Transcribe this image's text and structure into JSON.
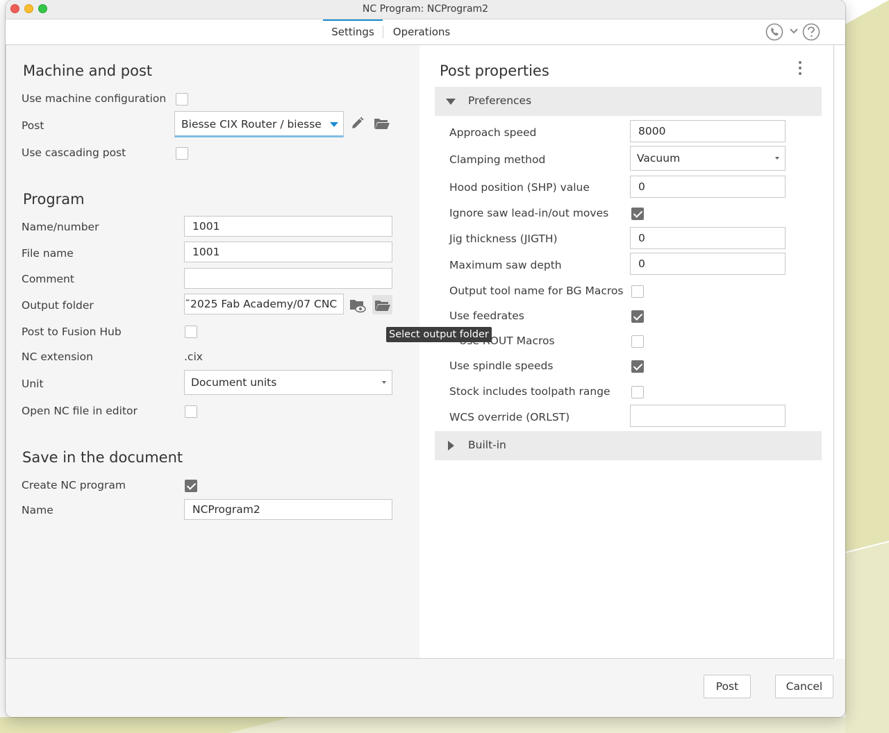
{
  "window": {
    "title": "NC Program: NCProgram2"
  },
  "tabs": [
    {
      "label": "Settings",
      "active": true
    },
    {
      "label": "Operations",
      "active": false
    }
  ],
  "header_icons": [
    "phone-support-icon",
    "chevron-down-icon",
    "help-icon"
  ],
  "machine_post": {
    "title": "Machine and post",
    "use_machine_config_label": "Use machine configuration",
    "use_machine_config_checked": false,
    "post_label": "Post",
    "post_value": "Biesse CIX Router / biesse",
    "use_cascading_label": "Use cascading post",
    "use_cascading_checked": false
  },
  "program": {
    "title": "Program",
    "name_number_label": "Name/number",
    "name_number_value": "1001",
    "file_name_label": "File name",
    "file_name_value": "1001",
    "comment_label": "Comment",
    "comment_value": "",
    "output_folder_label": "Output folder",
    "output_folder_value": "̃2025 Fab Academy/07 CNC",
    "post_to_hub_label": "Post to Fusion Hub",
    "post_to_hub_checked": false,
    "nc_extension_label": "NC extension",
    "nc_extension_value": ".cix",
    "unit_label": "Unit",
    "unit_value": "Document units",
    "open_in_editor_label": "Open NC file in editor",
    "open_in_editor_checked": false
  },
  "tooltip": "Select output folder",
  "save": {
    "title": "Save in the document",
    "create_label": "Create NC program",
    "create_checked": true,
    "name_label": "Name",
    "name_value": "NCProgram2"
  },
  "post_properties": {
    "title": "Post properties",
    "preferences_label": "Preferences",
    "builtin_label": "Built-in",
    "approach_speed_label": "Approach speed",
    "approach_speed_value": "8000",
    "clamping_label": "Clamping method",
    "clamping_value": "Vacuum",
    "hood_label": "Hood position (SHP) value",
    "hood_value": "0",
    "ignore_saw_label": "Ignore saw lead-in/out moves",
    "ignore_saw_checked": true,
    "jig_label": "Jig thickness (JIGTH)",
    "jig_value": "0",
    "max_saw_label": "Maximum saw depth",
    "max_saw_value": "0",
    "output_tool_label": "Output tool name for BG Macros",
    "output_tool_checked": false,
    "feedrates_label": "Use feedrates",
    "feedrates_checked": true,
    "rout_label": "Use ROUT Macros",
    "rout_checked": false,
    "spindle_label": "Use spindle speeds",
    "spindle_checked": true,
    "stock_label": "Stock includes toolpath range",
    "stock_checked": false,
    "wcs_label": "WCS override (ORLST)",
    "wcs_value": ""
  },
  "footer": {
    "post_label": "Post",
    "cancel_label": "Cancel"
  },
  "colors": {
    "accent": "#1e8bd2",
    "background_shape": "#e3e3b4"
  }
}
